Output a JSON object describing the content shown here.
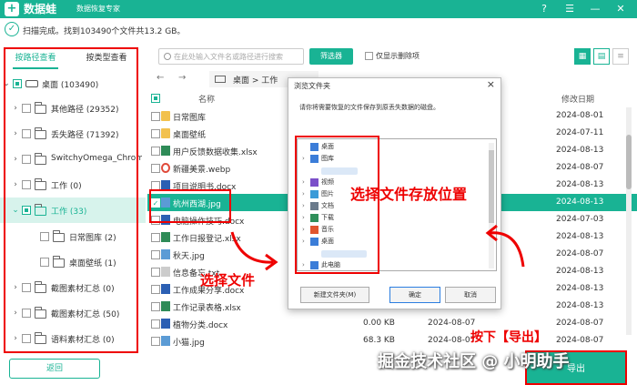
{
  "app": {
    "brand": "数据蛙",
    "subtitle": "数据恢复专家",
    "controls": [
      "?",
      "☰",
      "—",
      "✕"
    ]
  },
  "status": {
    "text": "扫描完成。找到103490个文件共13.2 GB。"
  },
  "sidebar": {
    "tabs": [
      "按路径查看",
      "按类型查看"
    ],
    "items": [
      {
        "label": "桌面 (103490)"
      },
      {
        "label": "其他路径 (29352)"
      },
      {
        "label": "丢失路径 (71392)"
      },
      {
        "label": "SwitchyOmega_Chromium"
      },
      {
        "label": "工作 (0)"
      },
      {
        "label": "工作 (33)"
      },
      {
        "label": "日常图库 (2)"
      },
      {
        "label": "桌面壁纸 (1)"
      },
      {
        "label": "截图素材汇总 (0)"
      },
      {
        "label": "截图素材汇总 (50)"
      },
      {
        "label": "语料素材汇总 (0)"
      }
    ],
    "back_label": "返回"
  },
  "toolbar": {
    "search_placeholder": "在此处输入文件名或路径进行搜索",
    "filter_label": "筛选器",
    "only_deleted_label": "仅显示删除项"
  },
  "nav": {
    "back": "←",
    "forward": "→",
    "breadcrumb": "桌面 > 工作"
  },
  "table": {
    "headers": {
      "name": "名称",
      "modified": "修改日期"
    },
    "rows": [
      {
        "name": "日常图库",
        "type": "fold",
        "size": "",
        "created": "",
        "modified": "2024-08-01",
        "selected": false
      },
      {
        "name": "桌面壁纸",
        "type": "fold",
        "size": "",
        "created": "",
        "modified": "2024-07-11",
        "selected": false
      },
      {
        "name": "用户反馈数据收集.xlsx",
        "type": "xlsx",
        "size": "",
        "created": "",
        "modified": "2024-08-13",
        "selected": false
      },
      {
        "name": "新疆美景.webp",
        "type": "webp",
        "size": "",
        "created": "",
        "modified": "2024-08-07",
        "selected": false
      },
      {
        "name": "项目说明书.docx",
        "type": "docx",
        "size": "",
        "created": "",
        "modified": "2024-08-13",
        "selected": false
      },
      {
        "name": "杭州西湖.jpg",
        "type": "jpg",
        "size": "",
        "created": "",
        "modified": "2024-08-13",
        "selected": true
      },
      {
        "name": "电脑操作技巧.docx",
        "type": "docx",
        "size": "",
        "created": "",
        "modified": "2024-07-03",
        "selected": false
      },
      {
        "name": "工作日报登记.xlsx",
        "type": "xlsx",
        "size": "",
        "created": "",
        "modified": "2024-08-13",
        "selected": false
      },
      {
        "name": "秋天.jpg",
        "type": "jpg",
        "size": "",
        "created": "",
        "modified": "2024-08-07",
        "selected": false
      },
      {
        "name": "信息备忘.txt",
        "type": "txt",
        "size": "",
        "created": "",
        "modified": "2024-08-13",
        "selected": false
      },
      {
        "name": "工作成果分享.docx",
        "type": "docx",
        "size": "",
        "created": "",
        "modified": "2024-08-13",
        "selected": false
      },
      {
        "name": "工作记录表格.xlsx",
        "type": "xlsx",
        "size": "",
        "created": "",
        "modified": "2024-08-13",
        "selected": false
      },
      {
        "name": "植物分类.docx",
        "type": "docx",
        "size": "0.00 KB",
        "created": "2024-08-07",
        "modified": "2024-08-07",
        "selected": false
      },
      {
        "name": "小猫.jpg",
        "type": "jpg",
        "size": "68.3 KB",
        "created": "2024-08-07",
        "modified": "2024-08-07",
        "selected": false
      }
    ]
  },
  "dialog": {
    "title": "浏览文件夹",
    "message": "请你将需要恢复的文件保存到原丢失数据的磁盘。",
    "tree": [
      {
        "label": "桌面",
        "chev": "",
        "icon": "#3b7dd8"
      },
      {
        "label": "图库",
        "chev": "›",
        "icon": "#3b7dd8"
      },
      {
        "label": "",
        "chev": "",
        "icon": ""
      },
      {
        "label": "视频",
        "chev": "›",
        "icon": "#7b4fc9"
      },
      {
        "label": "图片",
        "chev": "›",
        "icon": "#3b9bd8"
      },
      {
        "label": "文档",
        "chev": "›",
        "icon": "#6b7b8c"
      },
      {
        "label": "下载",
        "chev": "›",
        "icon": "#2f8f5a"
      },
      {
        "label": "音乐",
        "chev": "›",
        "icon": "#e0562f"
      },
      {
        "label": "桌面",
        "chev": "›",
        "icon": "#3b7dd8"
      },
      {
        "label": "",
        "chev": "",
        "icon": ""
      },
      {
        "label": "此电脑",
        "chev": "›",
        "icon": "#3b7dd8"
      }
    ],
    "buttons": {
      "new_folder": "新建文件夹(M)",
      "ok": "确定",
      "cancel": "取消"
    }
  },
  "export_label": "导出",
  "annotations": {
    "select_file": "选择文件",
    "choose_location": "选择文件存放位置",
    "press_export": "按下【导出】"
  },
  "watermark": "掘金技术社区 @ 小明助手",
  "colors": {
    "accent": "#19b394",
    "annotation": "#e00000"
  }
}
